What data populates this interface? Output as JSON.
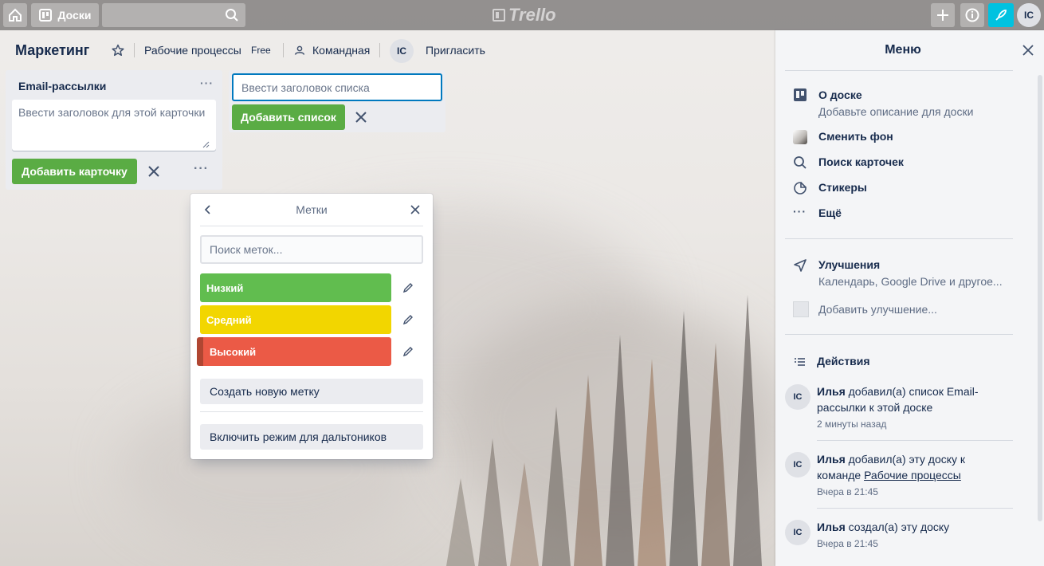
{
  "topbar": {
    "boards_label": "Доски",
    "logo_text": "Trello",
    "user_initials": "IC"
  },
  "board": {
    "title": "Маркетинг",
    "workspace": "Рабочие процессы",
    "plan": "Free",
    "visibility": "Командная",
    "member_initials": "IC",
    "invite_label": "Пригласить"
  },
  "list": {
    "title": "Email-рассылки",
    "card_placeholder": "Ввести заголовок для этой карточки",
    "add_card_label": "Добавить карточку"
  },
  "add_list": {
    "placeholder": "Ввести заголовок списка",
    "button_label": "Добавить список"
  },
  "labels_popup": {
    "title": "Метки",
    "search_placeholder": "Поиск меток...",
    "labels": [
      {
        "name": "Низкий",
        "color": "#61bd4f"
      },
      {
        "name": "Средний",
        "color": "#f2d600"
      },
      {
        "name": "Высокий",
        "color": "#eb5a46"
      }
    ],
    "create_label": "Создать новую метку",
    "colorblind_label": "Включить режим для дальтоников"
  },
  "menu": {
    "title": "Меню",
    "about_title": "О доске",
    "about_sub": "Добавьте описание для доски",
    "change_bg": "Сменить фон",
    "search_cards": "Поиск карточек",
    "stickers": "Стикеры",
    "more": "Ещё",
    "powerups_title": "Улучшения",
    "powerups_sub": "Календарь, Google Drive и другое...",
    "add_powerup": "Добавить улучшение...",
    "activity_title": "Действия",
    "activities": [
      {
        "user": "Илья",
        "text": " добавил(а) список Email-рассылки к этой доске",
        "link": "",
        "time": "2 минуты назад",
        "initials": "IC"
      },
      {
        "user": "Илья",
        "text": " добавил(а) эту доску к команде ",
        "link": "Рабочие процессы",
        "time": "Вчера в 21:45",
        "initials": "IC"
      },
      {
        "user": "Илья",
        "text": " создал(а) эту доску",
        "link": "",
        "time": "Вчера в 21:45",
        "initials": "IC"
      }
    ]
  },
  "colors": {
    "green_button": "#5aac44",
    "accent_blue": "#0079bf",
    "powerup_teal": "#00c2e0"
  }
}
